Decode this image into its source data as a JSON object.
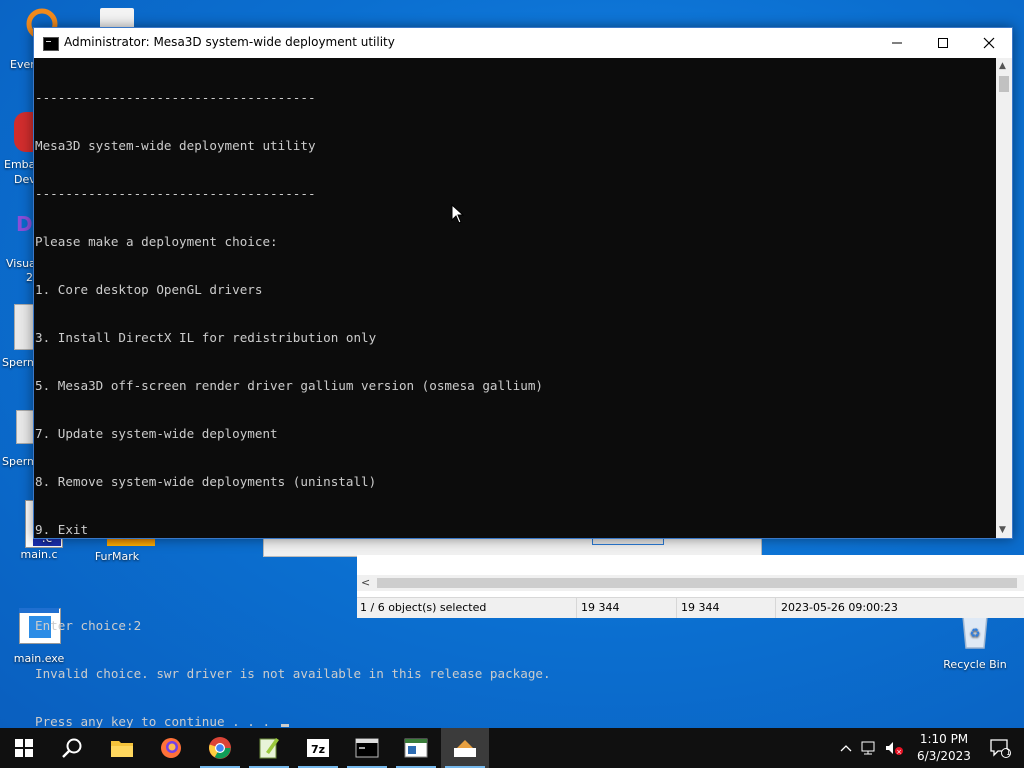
{
  "desktop": {
    "icons": [
      {
        "label": "main.c"
      },
      {
        "label": "FurMark"
      },
      {
        "label": "main.exe"
      },
      {
        "label": "Recycle Bin"
      }
    ],
    "cut_labels": [
      "Ever",
      "Emba",
      "Dev",
      "Visua",
      "2",
      "Sperm",
      "Sperm"
    ]
  },
  "background_window": {
    "status": {
      "selection": "1 / 6 object(s) selected",
      "size": "19 344",
      "packed_size": "19 344",
      "modified": "2023-05-26 09:00:23"
    }
  },
  "console_window": {
    "title": "Administrator:  Mesa3D system-wide deployment utility",
    "lines": [
      "-------------------------------------",
      "Mesa3D system-wide deployment utility",
      "-------------------------------------",
      "Please make a deployment choice:",
      "1. Core desktop OpenGL drivers",
      "3. Install DirectX IL for redistribution only",
      "5. Mesa3D off-screen render driver gallium version (osmesa gallium)",
      "7. Update system-wide deployment",
      "8. Remove system-wide deployments (uninstall)",
      "9. Exit",
      "",
      "Enter choice:2",
      "Invalid choice. swr driver is not available in this release package."
    ],
    "prompt_line": "Press any key to continue . . . ",
    "buttons": {
      "minimize": "—",
      "maximize": "☐",
      "close": "✕"
    }
  },
  "taskbar": {
    "apps": [
      "start-button",
      "search",
      "file-explorer",
      "firefox",
      "chrome",
      "notepad-plus-plus",
      "7-zip",
      "command-prompt",
      "app-window",
      "app-active"
    ],
    "clock": {
      "time": "1:10 PM",
      "date": "6/3/2023"
    },
    "notification_count": "1"
  }
}
